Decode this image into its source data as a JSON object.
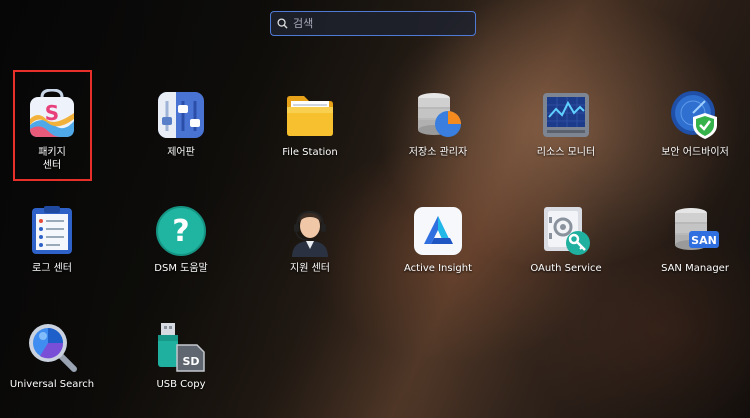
{
  "search": {
    "placeholder": "검색"
  },
  "apps": [
    {
      "id": "package-center",
      "label": "패키지\n센터",
      "icon": "package-icon"
    },
    {
      "id": "control-panel",
      "label": "제어판",
      "icon": "sliders-icon"
    },
    {
      "id": "file-station",
      "label": "File Station",
      "icon": "folder-icon"
    },
    {
      "id": "storage-manager",
      "label": "저장소 관리자",
      "icon": "database-pie-icon"
    },
    {
      "id": "resource-monitor",
      "label": "리소스 모니터",
      "icon": "monitor-graph-icon"
    },
    {
      "id": "security-advisor",
      "label": "보안 어드바이저",
      "icon": "shield-check-icon"
    },
    {
      "id": "log-center",
      "label": "로그 센터",
      "icon": "clipboard-list-icon"
    },
    {
      "id": "dsm-help",
      "label": "DSM 도움말",
      "icon": "question-icon"
    },
    {
      "id": "support-center",
      "label": "지원 센터",
      "icon": "headset-person-icon"
    },
    {
      "id": "active-insight",
      "label": "Active Insight",
      "icon": "active-insight-icon"
    },
    {
      "id": "oauth-service",
      "label": "OAuth Service",
      "icon": "safe-key-icon"
    },
    {
      "id": "san-manager",
      "label": "SAN Manager",
      "icon": "san-database-icon"
    },
    {
      "id": "universal-search",
      "label": "Universal Search",
      "icon": "magnifier-icon"
    },
    {
      "id": "usb-copy",
      "label": "USB Copy",
      "icon": "usb-sd-icon"
    }
  ],
  "badges": {
    "sd": "SD",
    "san": "SAN"
  }
}
